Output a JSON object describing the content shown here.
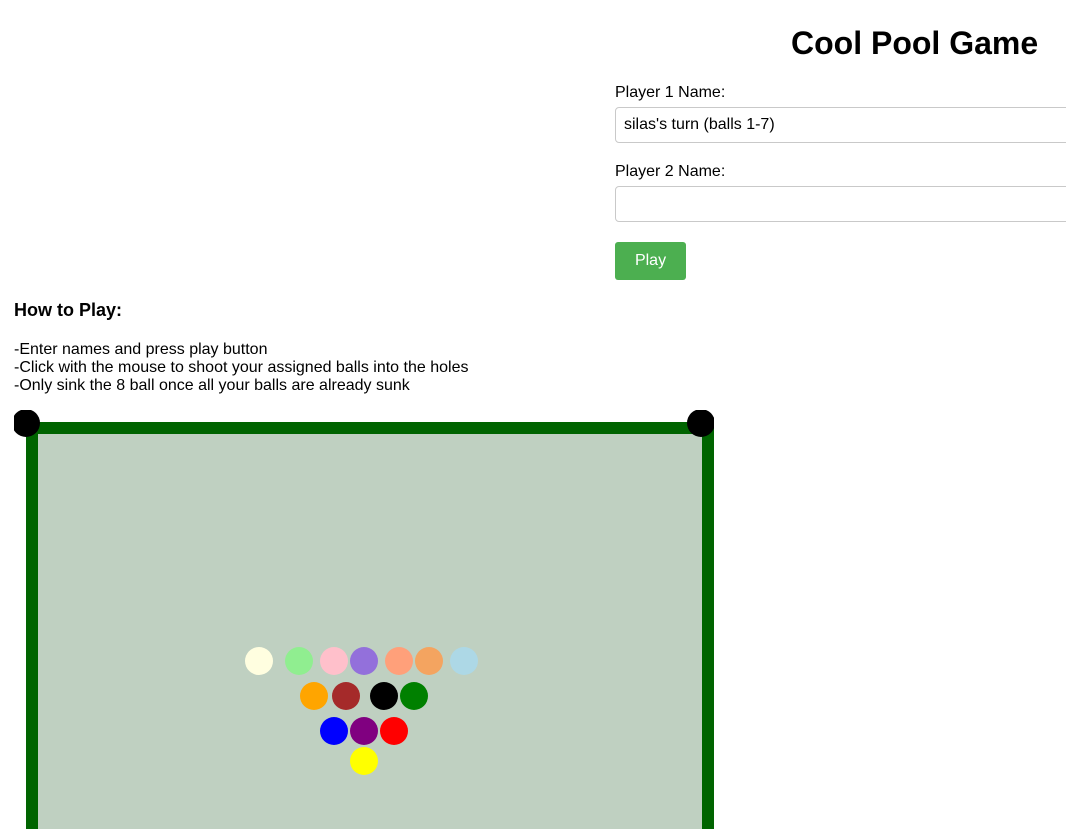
{
  "header": {
    "title": "Cool Pool Game"
  },
  "form": {
    "player1_label": "Player 1 Name:",
    "player1_value": "silas's turn (balls 1-7)",
    "player2_label": "Player 2 Name:",
    "player2_value": "",
    "play_label": "Play"
  },
  "how_to": {
    "title": "How to Play:",
    "lines": [
      "-Enter names and press play button",
      "-Click with the mouse to shoot your assigned balls into the holes",
      "-Only sink the 8 ball once all your balls are already sunk"
    ]
  },
  "table": {
    "felt_color": "#bfd0c1",
    "rail_color": "#006400",
    "pocket_color": "#000000",
    "balls": [
      {
        "name": "cue-ball",
        "color": "#fffee0"
      },
      {
        "name": "ball-lightgreen",
        "color": "#90ee90"
      },
      {
        "name": "ball-pink",
        "color": "#ffc0cb"
      },
      {
        "name": "ball-mediumpurple",
        "color": "#9370db"
      },
      {
        "name": "ball-lightsalmon",
        "color": "#ffa07a"
      },
      {
        "name": "ball-sandybrown",
        "color": "#f4a460"
      },
      {
        "name": "ball-lightblue",
        "color": "#add8e6"
      },
      {
        "name": "ball-orange",
        "color": "#ffa500"
      },
      {
        "name": "ball-brown",
        "color": "#a52a2a"
      },
      {
        "name": "eight-ball",
        "color": "#000000"
      },
      {
        "name": "ball-green",
        "color": "#008000"
      },
      {
        "name": "ball-blue",
        "color": "#0000ff"
      },
      {
        "name": "ball-purple",
        "color": "#800080"
      },
      {
        "name": "ball-red",
        "color": "#ff0000"
      },
      {
        "name": "ball-yellow",
        "color": "#ffff00"
      }
    ]
  }
}
